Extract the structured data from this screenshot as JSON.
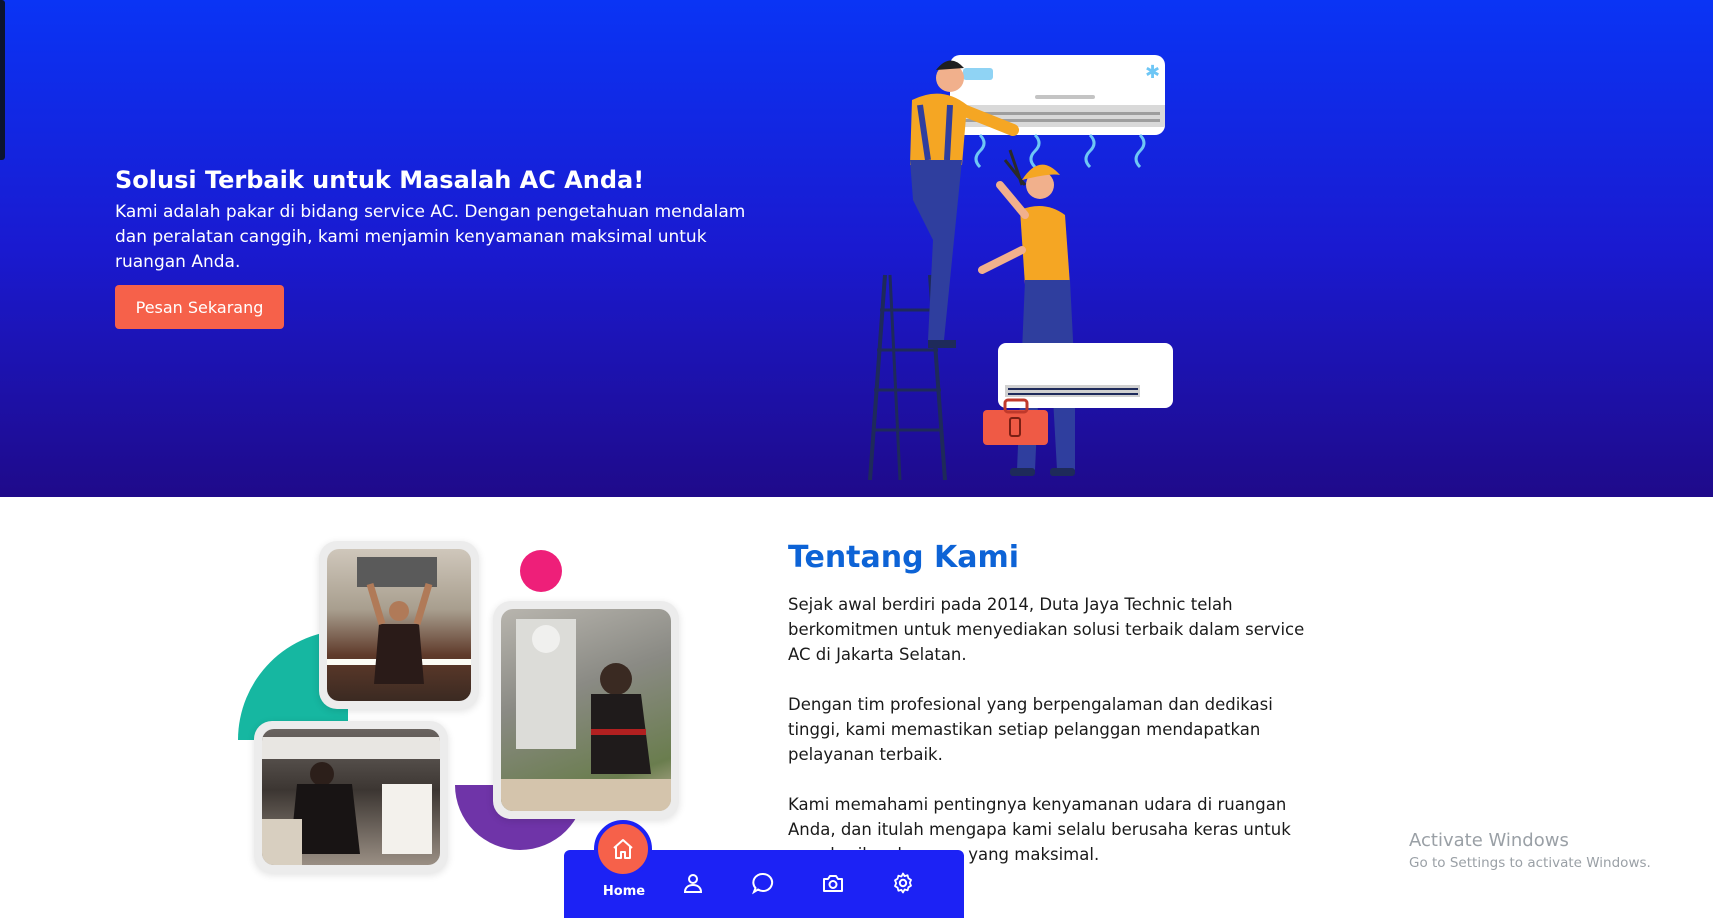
{
  "hero": {
    "title": "Solusi Terbaik untuk Masalah AC Anda!",
    "description": "Kami adalah pakar di bidang service AC. Dengan pengetahuan mendalam dan peralatan canggih, kami menjamin kenyamanan maksimal untuk ruangan Anda.",
    "cta_label": "Pesan Sekarang",
    "illustration": "ac-technicians-illustration"
  },
  "about": {
    "title": "Tentang Kami",
    "paragraphs": [
      "Sejak awal berdiri pada 2014, Duta Jaya Technic telah berkomitmen untuk menyediakan solusi terbaik dalam service AC di Jakarta Selatan.",
      "Dengan tim profesional yang berpengalaman dan dedikasi tinggi, kami memastikan setiap pelanggan mendapatkan pelayanan terbaik.",
      "Kami memahami pentingnya kenyamanan udara di ruangan Anda, dan itulah mengapa kami selalu berusaha keras untuk memberikan layanan yang maksimal."
    ],
    "photos": [
      "technician-ceiling-ac-photo",
      "technician-outdoor-unit-photo",
      "technician-wall-ac-photo"
    ]
  },
  "bottom_nav": {
    "home_label": "Home",
    "icons": [
      "home-icon",
      "user-icon",
      "chat-icon",
      "camera-icon",
      "gear-icon"
    ]
  },
  "watermark": {
    "line1": "Activate Windows",
    "line2": "Go to Settings to activate Windows."
  },
  "colors": {
    "hero_top": "#0a34f5",
    "hero_bottom": "#1f0a8a",
    "accent": "#f6614a",
    "title_blue": "#0d63d6",
    "nav": "#1c22f5"
  }
}
